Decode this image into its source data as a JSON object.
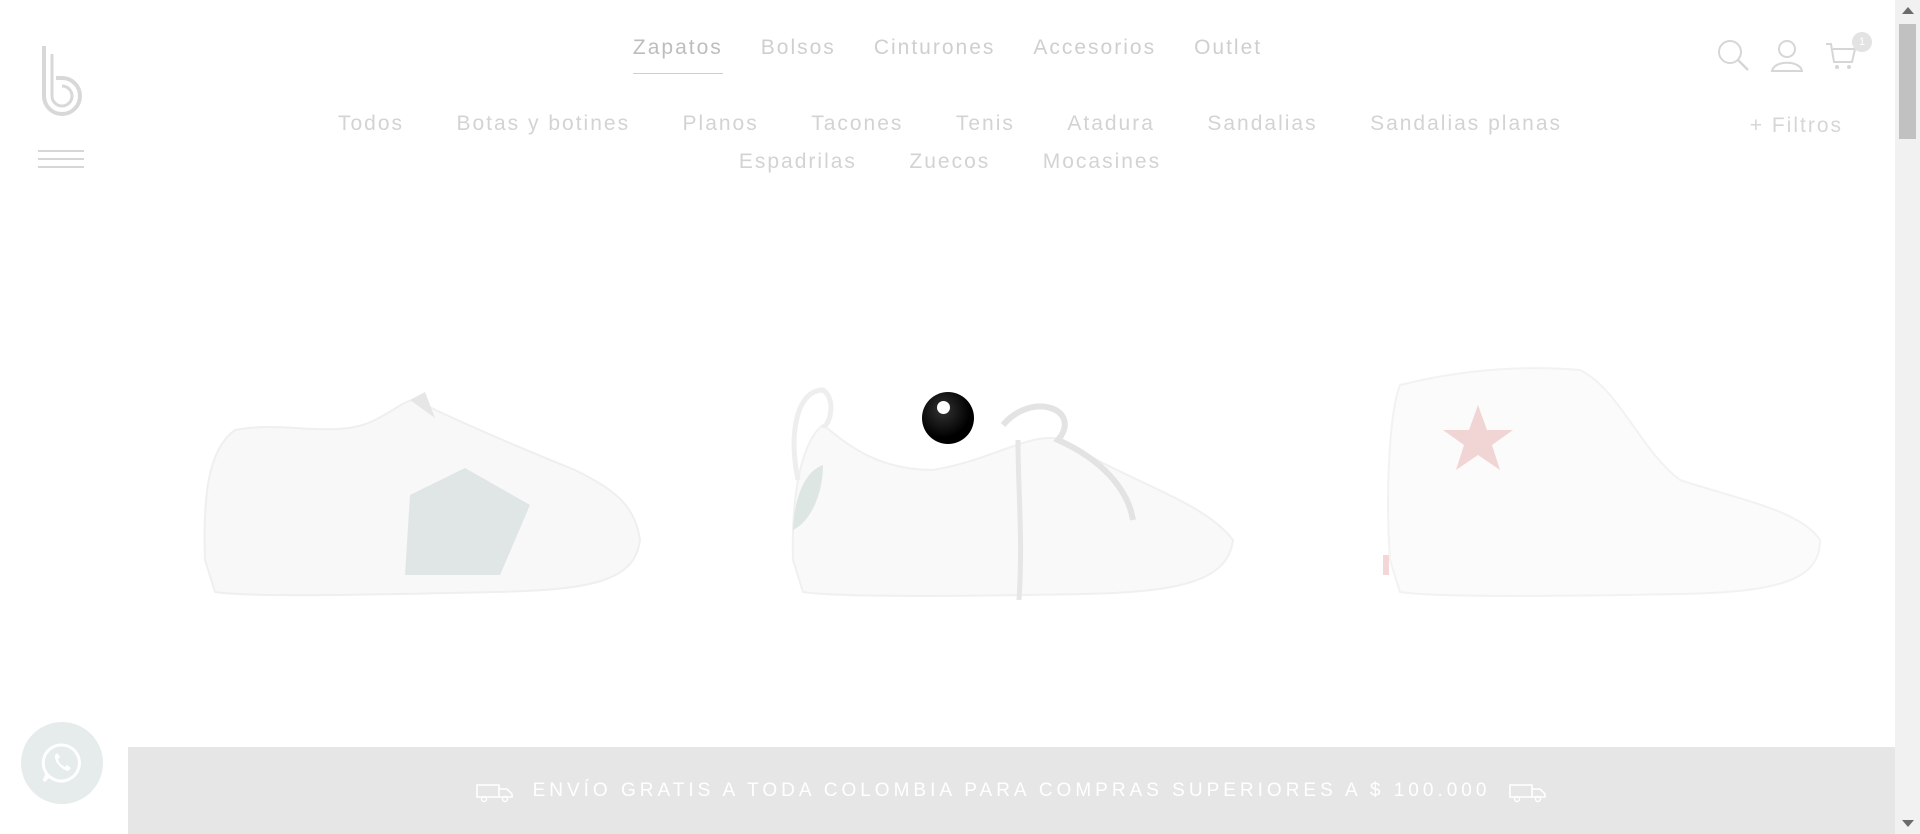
{
  "nav": {
    "items": [
      {
        "label": "Zapatos",
        "active": true
      },
      {
        "label": "Bolsos"
      },
      {
        "label": "Cinturones"
      },
      {
        "label": "Accesorios"
      },
      {
        "label": "Outlet"
      }
    ]
  },
  "header": {
    "icons": [
      "search-icon",
      "user-icon",
      "cart-icon"
    ],
    "cart_count": "1"
  },
  "subnav": {
    "items": [
      "Todos",
      "Botas y botines",
      "Planos",
      "Tacones",
      "Tenis",
      "Atadura",
      "Sandalias",
      "Sandalias planas",
      "Espadrilas",
      "Zuecos",
      "Mocasines"
    ],
    "filters_label": "+ Filtros"
  },
  "banner": {
    "text": "ENVÍO GRATIS A TODA COLOMBIA PARA COMPRAS SUPERIORES A $ 100.000"
  },
  "colors": {
    "nav_text": "#cfcfcf",
    "banner_bg": "#e6e6e6"
  }
}
